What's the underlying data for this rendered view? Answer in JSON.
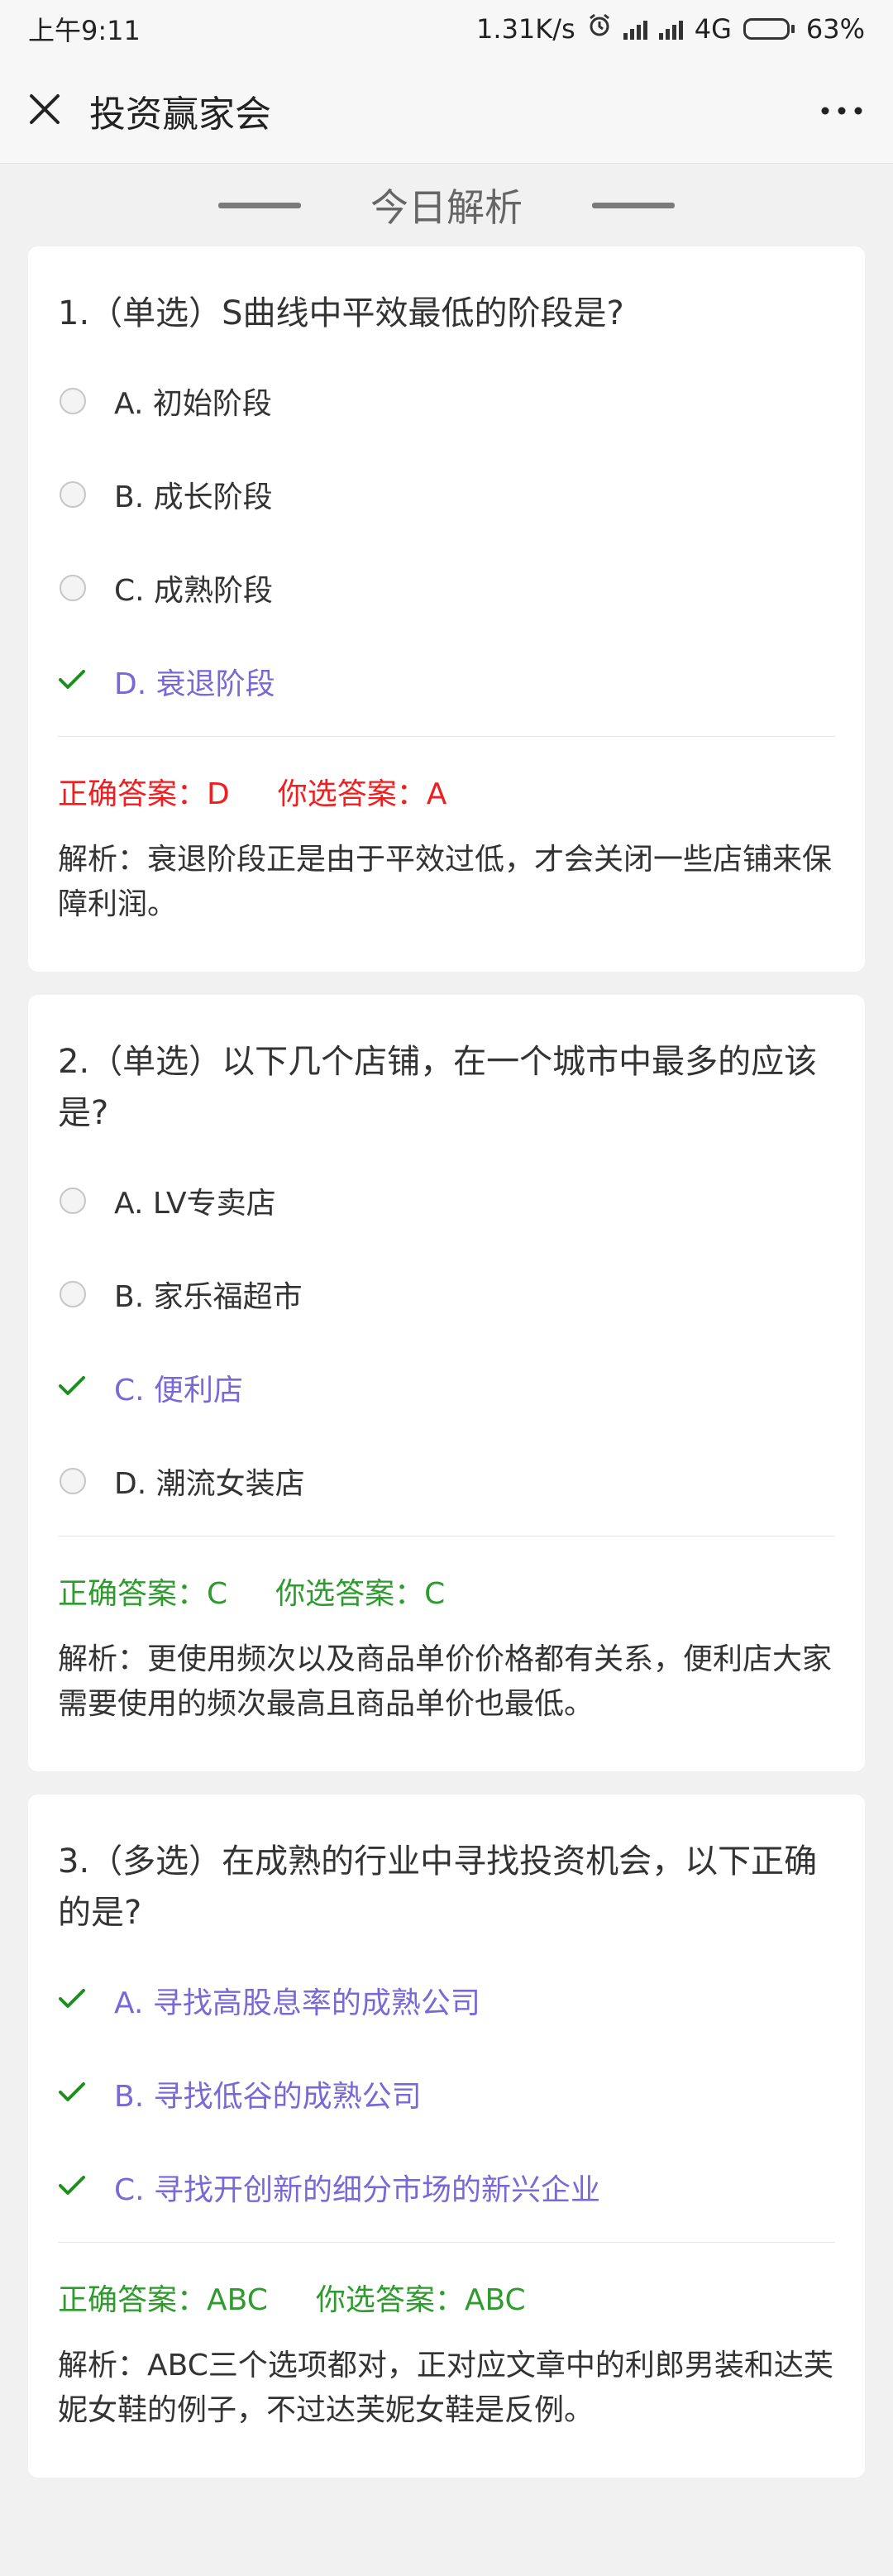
{
  "status": {
    "time": "上午9:11",
    "speed": "1.31K/s",
    "network": "4G",
    "battery": "63%",
    "battery_level": 0.63
  },
  "nav": {
    "title": "投资赢家会"
  },
  "section_title": "今日解析",
  "questions": [
    {
      "title": "1.（单选）S曲线中平效最低的阶段是?",
      "options": [
        {
          "label": "A. 初始阶段",
          "correct": false
        },
        {
          "label": "B. 成长阶段",
          "correct": false
        },
        {
          "label": "C. 成熟阶段",
          "correct": false
        },
        {
          "label": "D. 衰退阶段",
          "correct": true
        }
      ],
      "correct_answer": "正确答案：D",
      "your_answer": "你选答案：A",
      "is_right": false,
      "analysis": "解析：衰退阶段正是由于平效过低，才会关闭一些店铺来保障利润。"
    },
    {
      "title": "2.（单选）以下几个店铺，在一个城市中最多的应该是?",
      "options": [
        {
          "label": "A. LV专卖店",
          "correct": false
        },
        {
          "label": "B. 家乐福超市",
          "correct": false
        },
        {
          "label": "C. 便利店",
          "correct": true
        },
        {
          "label": "D. 潮流女装店",
          "correct": false
        }
      ],
      "correct_answer": "正确答案：C",
      "your_answer": "你选答案：C",
      "is_right": true,
      "analysis": "解析：更使用频次以及商品单价价格都有关系，便利店大家需要使用的频次最高且商品单价也最低。"
    },
    {
      "title": "3.（多选）在成熟的行业中寻找投资机会，以下正确的是?",
      "options": [
        {
          "label": "A. 寻找高股息率的成熟公司",
          "correct": true
        },
        {
          "label": "B. 寻找低谷的成熟公司",
          "correct": true
        },
        {
          "label": "C. 寻找开创新的细分市场的新兴企业",
          "correct": true
        }
      ],
      "correct_answer": "正确答案：ABC",
      "your_answer": "你选答案：ABC",
      "is_right": true,
      "analysis": "解析：ABC三个选项都对，正对应文章中的利郎男装和达芙妮女鞋的例子，不过达芙妮女鞋是反例。"
    }
  ],
  "colors": {
    "correct_option": "#7b68d6",
    "check_icon": "#1e8f1e",
    "wrong_answer": "#f01e1e",
    "right_answer": "#2e9b2e"
  }
}
